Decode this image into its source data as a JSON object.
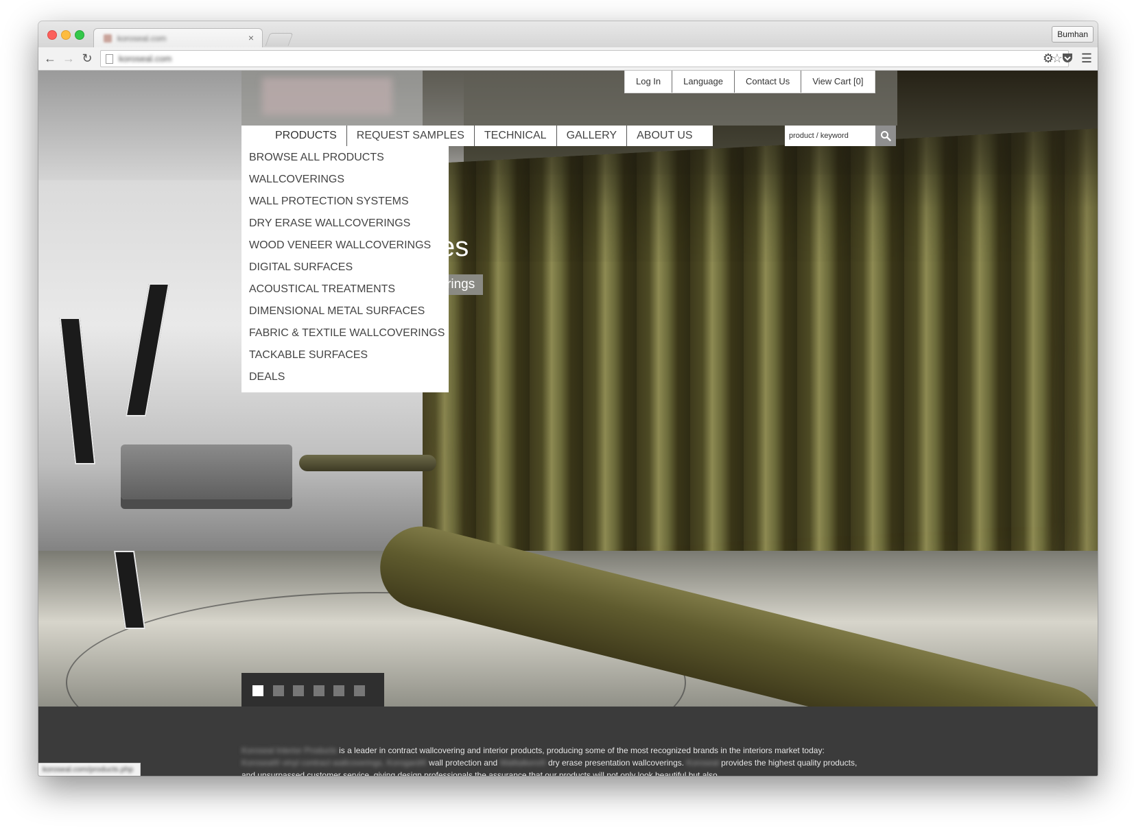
{
  "browser": {
    "tab_title": "koroseal.com",
    "tab_close": "×",
    "profile_name": "Bumhan",
    "url": "koroseal.com",
    "status_url": "koroseal.com/products.php"
  },
  "utility_nav": {
    "items": [
      "Log In",
      "Language",
      "Contact Us",
      "View Cart [0]"
    ]
  },
  "main_nav": {
    "items": [
      "PRODUCTS",
      "REQUEST SAMPLES",
      "TECHNICAL",
      "GALLERY",
      "ABOUT US"
    ]
  },
  "search": {
    "placeholder": "product / keyword"
  },
  "products_dropdown": {
    "items": [
      "BROWSE ALL PRODUCTS",
      "WALLCOVERINGS",
      "WALL PROTECTION SYSTEMS",
      "DRY ERASE WALLCOVERINGS",
      "WOOD VENEER WALLCOVERINGS",
      "DIGITAL SURFACES",
      "ACOUSTICAL TREATMENTS",
      "DIMENSIONAL METAL SURFACES",
      "FABRIC & TEXTILE WALLCOVERINGS",
      "TACKABLE SURFACES",
      "DEALS"
    ]
  },
  "hero": {
    "caption_big": "ces",
    "caption_small": "verings",
    "slide_count": 6,
    "active_slide": 1
  },
  "intro": {
    "company": "Koroseal Interior Products",
    "line1": "is a leader in contract wallcovering and interior products, producing some of the most recognized brands in the interiors market today:",
    "brand1": "Koroseal® vinyl contract wallcoverings,",
    "brand2": "Korogard®",
    "line2a": "wall protection and",
    "brand3": "Walltalkers®",
    "line2b": "dry erase presentation wallcoverings.",
    "company_short": "Koroseal",
    "line2c": "provides the highest quality products,",
    "line3": "and unsurpassed customer service, giving design professionals the assurance that our products will not only look beautiful but also"
  },
  "colors": {
    "nav_bg": "#ffffff",
    "nav_text": "#444444",
    "footer_bg": "#3b3b3b",
    "search_button": "#8f8f8f"
  }
}
